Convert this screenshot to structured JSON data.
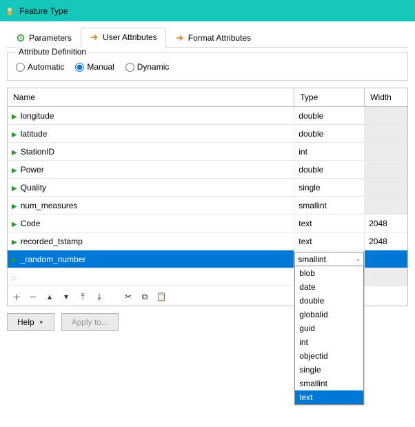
{
  "window": {
    "title": "Feature Type"
  },
  "tabs": {
    "parameters": "Parameters",
    "user_attributes": "User Attributes",
    "format_attributes": "Format Attributes"
  },
  "attribute_definition": {
    "legend": "Attribute Definition",
    "automatic": "Automatic",
    "manual": "Manual",
    "dynamic": "Dynamic"
  },
  "grid": {
    "headers": {
      "name": "Name",
      "type": "Type",
      "width": "Width"
    },
    "rows": [
      {
        "name": "longitude",
        "type": "double",
        "width": ""
      },
      {
        "name": "latitude",
        "type": "double",
        "width": ""
      },
      {
        "name": "StationID",
        "type": "int",
        "width": ""
      },
      {
        "name": "Power",
        "type": "double",
        "width": ""
      },
      {
        "name": "Quality",
        "type": "single",
        "width": ""
      },
      {
        "name": "num_measures",
        "type": "smallint",
        "width": ""
      },
      {
        "name": "Code",
        "type": "text",
        "width": "2048"
      },
      {
        "name": "recorded_tstamp",
        "type": "text",
        "width": "2048"
      },
      {
        "name": "_random_number",
        "type": "smallint",
        "width": ""
      }
    ]
  },
  "type_dropdown": {
    "options": [
      "blob",
      "date",
      "double",
      "globalid",
      "guid",
      "int",
      "objectid",
      "single",
      "smallint",
      "text"
    ],
    "selected": "text"
  },
  "buttons": {
    "help": "Help",
    "apply_to": "Apply to..."
  }
}
